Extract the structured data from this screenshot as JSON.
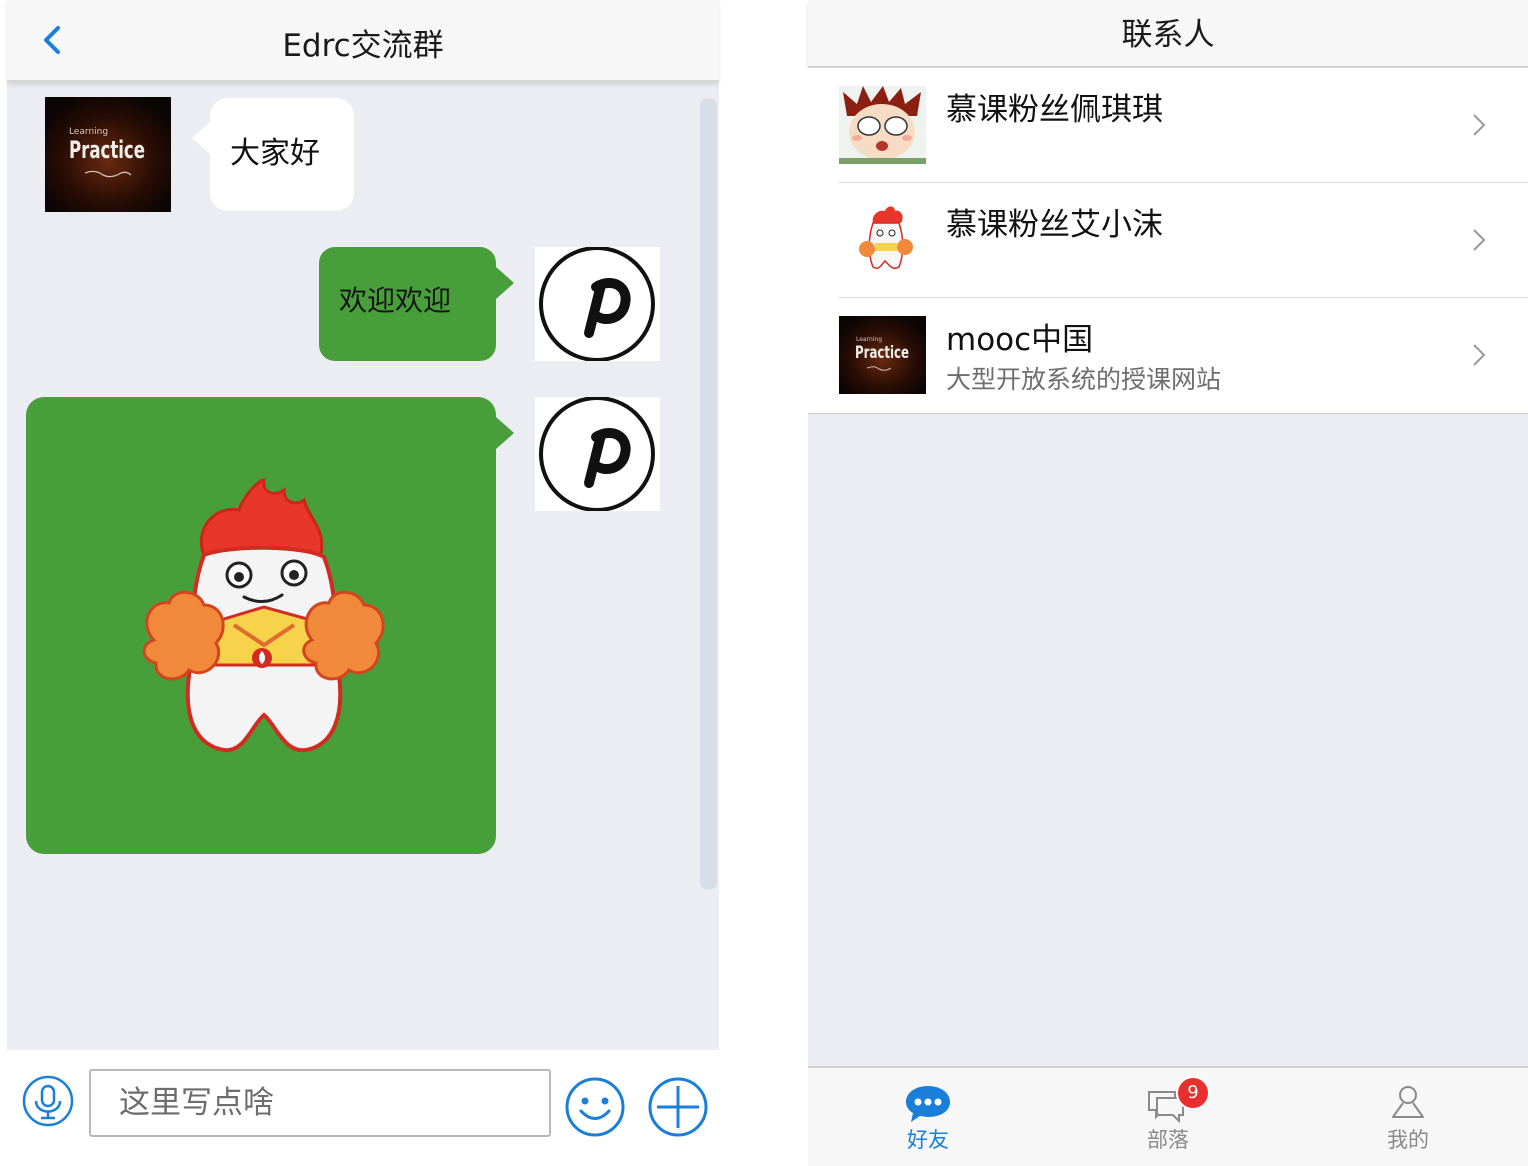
{
  "chat": {
    "title": "Edrc交流群",
    "messages": [
      {
        "side": "left",
        "text": "大家好",
        "avatar": "practice-logo"
      },
      {
        "side": "right",
        "text": "欢迎欢迎",
        "avatar": "pinterest-icon"
      },
      {
        "side": "right",
        "image": "mascot-sticker",
        "avatar": "pinterest-icon"
      }
    ],
    "input": {
      "placeholder": "这里写点啥",
      "value": ""
    },
    "avatar_logo_text": "Practice",
    "colors": {
      "sent_bubble": "#489e3a",
      "received_bubble": "#ffffff",
      "accent": "#1a7fd8"
    }
  },
  "contacts": {
    "title": "联系人",
    "items": [
      {
        "name": "慕课粉丝佩琪琪",
        "subtitle": "",
        "avatar": "anime-avatar"
      },
      {
        "name": "慕课粉丝艾小沫",
        "subtitle": "",
        "avatar": "mascot-avatar"
      },
      {
        "name": "mooc中国",
        "subtitle": "大型开放系统的授课网站",
        "avatar": "practice-logo"
      }
    ],
    "tabs": [
      {
        "label": "好友",
        "icon": "chat-bubble-icon",
        "active": true
      },
      {
        "label": "部落",
        "icon": "group-chat-icon",
        "badge": "9"
      },
      {
        "label": "我的",
        "icon": "person-icon"
      }
    ]
  }
}
